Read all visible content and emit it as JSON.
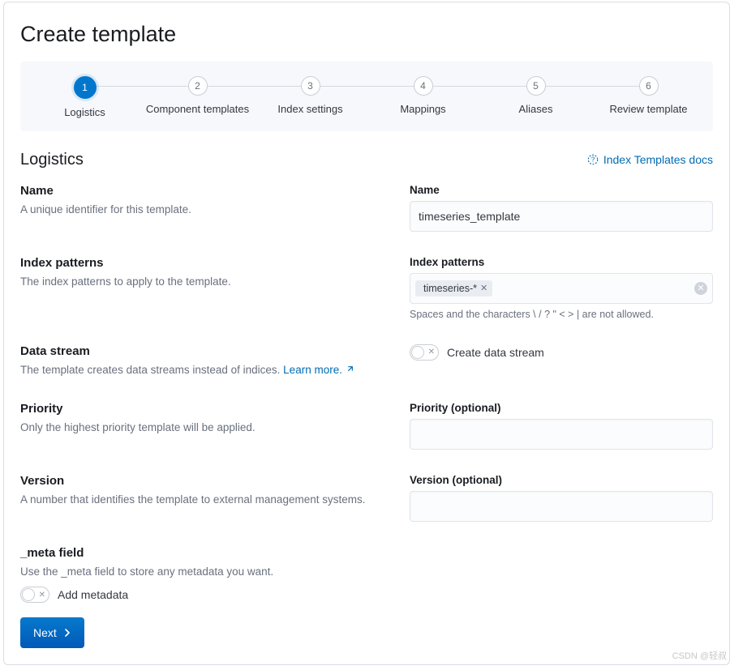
{
  "page": {
    "title": "Create template",
    "watermark": "CSDN @轻叔"
  },
  "stepper": {
    "steps": [
      {
        "num": "1",
        "label": "Logistics",
        "active": true
      },
      {
        "num": "2",
        "label": "Component templates"
      },
      {
        "num": "3",
        "label": "Index settings"
      },
      {
        "num": "4",
        "label": "Mappings"
      },
      {
        "num": "5",
        "label": "Aliases"
      },
      {
        "num": "6",
        "label": "Review template"
      }
    ]
  },
  "section": {
    "title": "Logistics",
    "docs_link": "Index Templates docs"
  },
  "groups": {
    "name": {
      "title": "Name",
      "desc": "A unique identifier for this template.",
      "field_label": "Name",
      "value": "timeseries_template"
    },
    "index_patterns": {
      "title": "Index patterns",
      "desc": "The index patterns to apply to the template.",
      "field_label": "Index patterns",
      "pill": "timeseries-*",
      "help": "Spaces and the characters \\ / ? \" < > | are not allowed."
    },
    "data_stream": {
      "title": "Data stream",
      "desc_prefix": "The template creates data streams instead of indices. ",
      "learn_more": "Learn more.",
      "toggle_label": "Create data stream"
    },
    "priority": {
      "title": "Priority",
      "desc": "Only the highest priority template will be applied.",
      "field_label": "Priority (optional)"
    },
    "version": {
      "title": "Version",
      "desc": "A number that identifies the template to external management systems.",
      "field_label": "Version (optional)"
    },
    "meta": {
      "title": "_meta field",
      "desc": "Use the _meta field to store any metadata you want.",
      "toggle_label": "Add metadata"
    }
  },
  "next_label": "Next"
}
